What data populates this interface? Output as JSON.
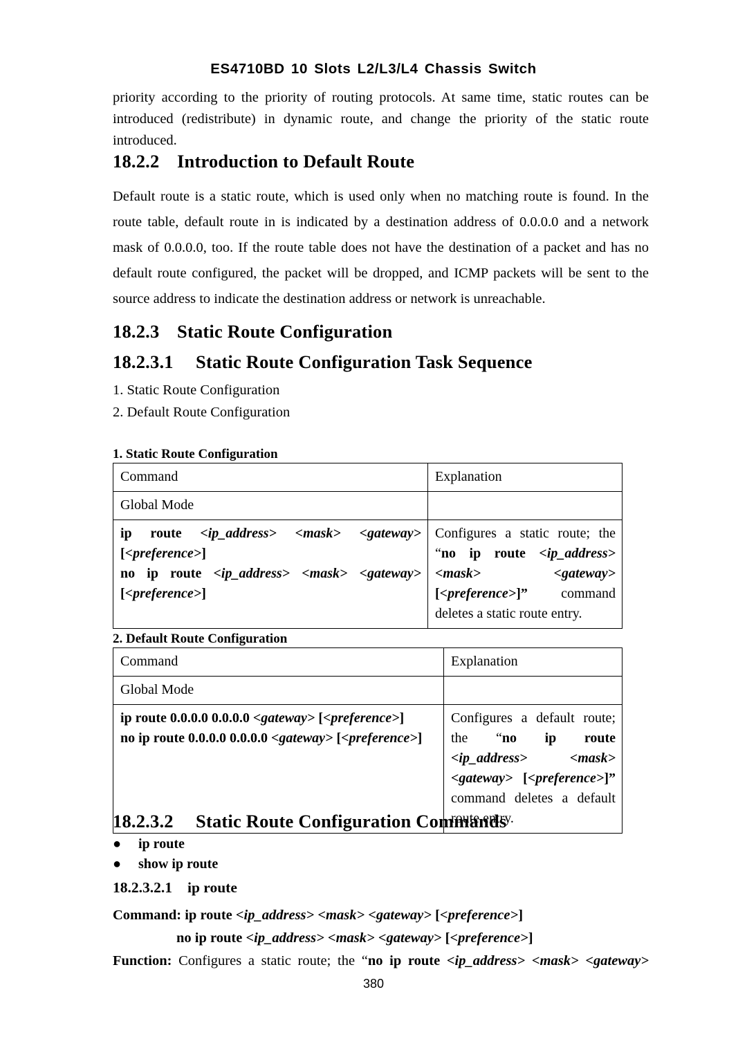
{
  "header": {
    "running_title": "ES4710BD 10 Slots L2/L3/L4 Chassis Switch"
  },
  "intro_paragraph": "priority according to the priority of routing protocols. At same time, static routes can be introduced (redistribute) in dynamic route, and change the priority of the static route introduced.",
  "sections": {
    "default_route": {
      "number": "18.2.2",
      "title": "Introduction to Default Route",
      "body": "Default route is a static route, which is used only when no matching route is found. In the route table, default route in is indicated by a destination address of 0.0.0.0 and a network mask of 0.0.0.0, too. If the route table does not have the destination of a packet and has no default route configured, the packet will be dropped, and ICMP packets will be sent to the source address to indicate the destination address or network is unreachable."
    },
    "static_route_config": {
      "number": "18.2.3",
      "title": "Static Route Configuration"
    },
    "task_sequence": {
      "number": "18.2.3.1",
      "title": "Static Route Configuration Task Sequence",
      "items": [
        "1. Static Route Configuration",
        "2. Default Route Configuration"
      ]
    },
    "config_commands": {
      "number": "18.2.3.2",
      "title": "Static Route Configuration Commands",
      "bullets": [
        "ip route",
        "show ip route"
      ],
      "bullet_glyph": "●"
    },
    "ip_route": {
      "number": "18.2.3.2.1",
      "title": "ip route"
    }
  },
  "tables": [
    {
      "caption": "1. Static Route Configuration",
      "headers": [
        "Command",
        "Explanation"
      ],
      "mode_row": [
        "Global Mode",
        ""
      ],
      "command_cell": {
        "line1": [
          {
            "t": "ip",
            "s": "b"
          },
          {
            "t": " route ",
            "s": "b"
          },
          {
            "t": "<ip_address>",
            "s": "bi"
          },
          {
            "t": " ",
            "s": "b"
          },
          {
            "t": "<mask>",
            "s": "bi"
          },
          {
            "t": " ",
            "s": "b"
          },
          {
            "t": "<gateway>",
            "s": "bi"
          },
          {
            "t": " [",
            "s": "b"
          },
          {
            "t": "<preference>",
            "s": "bi"
          },
          {
            "t": "]",
            "s": "b"
          }
        ],
        "line2": [
          {
            "t": "no ip route ",
            "s": "b"
          },
          {
            "t": "<ip_address>",
            "s": "bi"
          },
          {
            "t": " ",
            "s": "b"
          },
          {
            "t": "<mask>",
            "s": "bi"
          },
          {
            "t": " ",
            "s": "b"
          },
          {
            "t": "<gateway>",
            "s": "bi"
          },
          {
            "t": " [",
            "s": "b"
          },
          {
            "t": "<preference>",
            "s": "bi"
          },
          {
            "t": "]",
            "s": "b"
          }
        ]
      },
      "explanation_cell": [
        {
          "t": "Configures a static route;  the “",
          "s": ""
        },
        {
          "t": "no ip route ",
          "s": "b"
        },
        {
          "t": "<ip_address> <mask> <gateway>",
          "s": "bi"
        },
        {
          "t": " [",
          "s": "b"
        },
        {
          "t": "<preference>",
          "s": "bi"
        },
        {
          "t": "]”",
          "s": "b"
        },
        {
          "t": " command deletes a static route entry.",
          "s": ""
        }
      ]
    },
    {
      "caption": "2. Default Route Configuration",
      "headers": [
        "Command",
        "Explanation"
      ],
      "mode_row": [
        "Global Mode",
        ""
      ],
      "command_cell": {
        "line1": [
          {
            "t": "ip route 0.0.0.0 0.0.0.0 ",
            "s": "b"
          },
          {
            "t": "<gateway>",
            "s": "bi"
          },
          {
            "t": "   [",
            "s": "b"
          },
          {
            "t": "<preference>",
            "s": "bi"
          },
          {
            "t": "]",
            "s": "b"
          }
        ],
        "line2": [
          {
            "t": "no ip route 0.0.0.0 0.0.0.0 ",
            "s": "b"
          },
          {
            "t": "<gateway>",
            "s": "bi"
          },
          {
            "t": " [",
            "s": "b"
          },
          {
            "t": "<preference>",
            "s": "bi"
          },
          {
            "t": "]",
            "s": "b"
          }
        ]
      },
      "explanation_cell": [
        {
          "t": "Configures a default route; the “",
          "s": ""
        },
        {
          "t": "no ip route ",
          "s": "b"
        },
        {
          "t": "<ip_address> <mask> <gateway>",
          "s": "bi"
        },
        {
          "t": " [",
          "s": "b"
        },
        {
          "t": "<preference>",
          "s": "bi"
        },
        {
          "t": "]”",
          "s": "b"
        },
        {
          "t": " command deletes a default route entry.",
          "s": ""
        }
      ]
    }
  ],
  "command_block": {
    "command_label": "Command:",
    "command_line1": [
      {
        "t": "ip route ",
        "s": "b"
      },
      {
        "t": "<ip_address> <mask> <gateway>",
        "s": "bi"
      },
      {
        "t": " [",
        "s": "b"
      },
      {
        "t": "<preference>",
        "s": "bi"
      },
      {
        "t": "]",
        "s": "b"
      }
    ],
    "command_line2": [
      {
        "t": "no ip route ",
        "s": "b"
      },
      {
        "t": "<ip_address> <mask> <gateway>",
        "s": "bi"
      },
      {
        "t": " [",
        "s": "b"
      },
      {
        "t": "<preference>",
        "s": "bi"
      },
      {
        "t": "]",
        "s": "b"
      }
    ],
    "function_label": "Function:",
    "function_line": [
      {
        "t": " Configures a static route;   the “",
        "s": ""
      },
      {
        "t": "no ip route ",
        "s": "b"
      },
      {
        "t": "<ip_address> <mask> <gateway>",
        "s": "bi"
      }
    ]
  },
  "folio": "380"
}
